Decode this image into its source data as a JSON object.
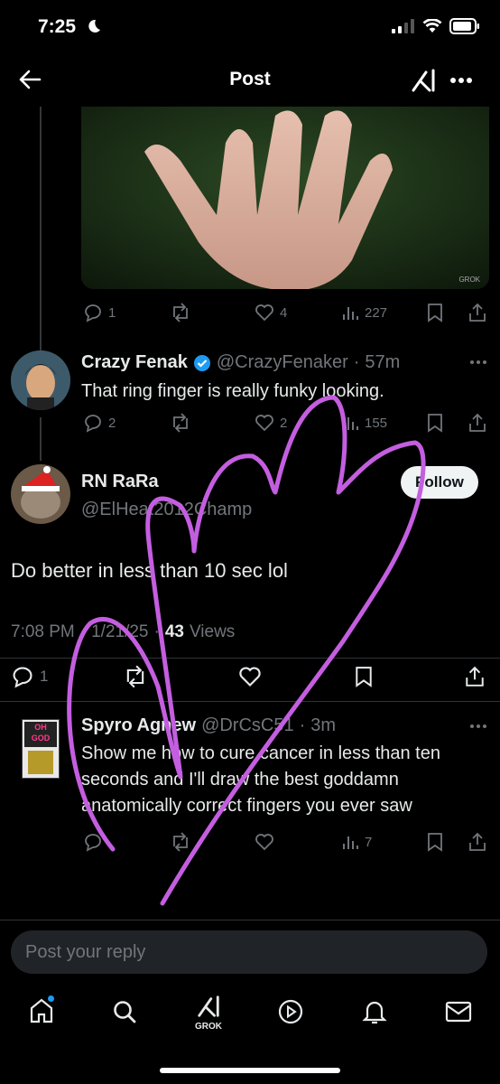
{
  "status": {
    "time": "7:25"
  },
  "header": {
    "title": "Post"
  },
  "image_post": {
    "watermark": "GROK",
    "actions": {
      "replies": "1",
      "reposts": "",
      "likes": "4",
      "views": "227"
    }
  },
  "reply1": {
    "name": "Crazy Fenak",
    "handle": "@CrazyFenaker",
    "time": "57m",
    "text": "That ring finger is really funky looking.",
    "actions": {
      "replies": "2",
      "likes": "2",
      "views": "155"
    }
  },
  "main_post": {
    "name": "RN RaRa",
    "handle": "@ElHeat2012Champ",
    "follow_label": "Follow",
    "text": "Do better in less than 10 sec lol",
    "time": "7:08 PM",
    "date": "1/21/25",
    "views_count": "43",
    "views_label": "Views",
    "actions": {
      "replies": "1"
    }
  },
  "reply2": {
    "name": "Spyro Agnew",
    "handle": "@DrCsC51",
    "time": "3m",
    "text": "Show me how to cure cancer in less than ten seconds and I'll draw the best goddamn anatomically correct fingers you ever saw",
    "avatar_text": "OH GOD",
    "actions": {
      "views": "7"
    }
  },
  "reply_input": {
    "placeholder": "Post your reply"
  },
  "tabbar": {
    "grok_label": "GROK"
  },
  "colors": {
    "verified": "#1d9bf0",
    "drawing": "#c45ee0",
    "badge": "#1d9bf0"
  }
}
